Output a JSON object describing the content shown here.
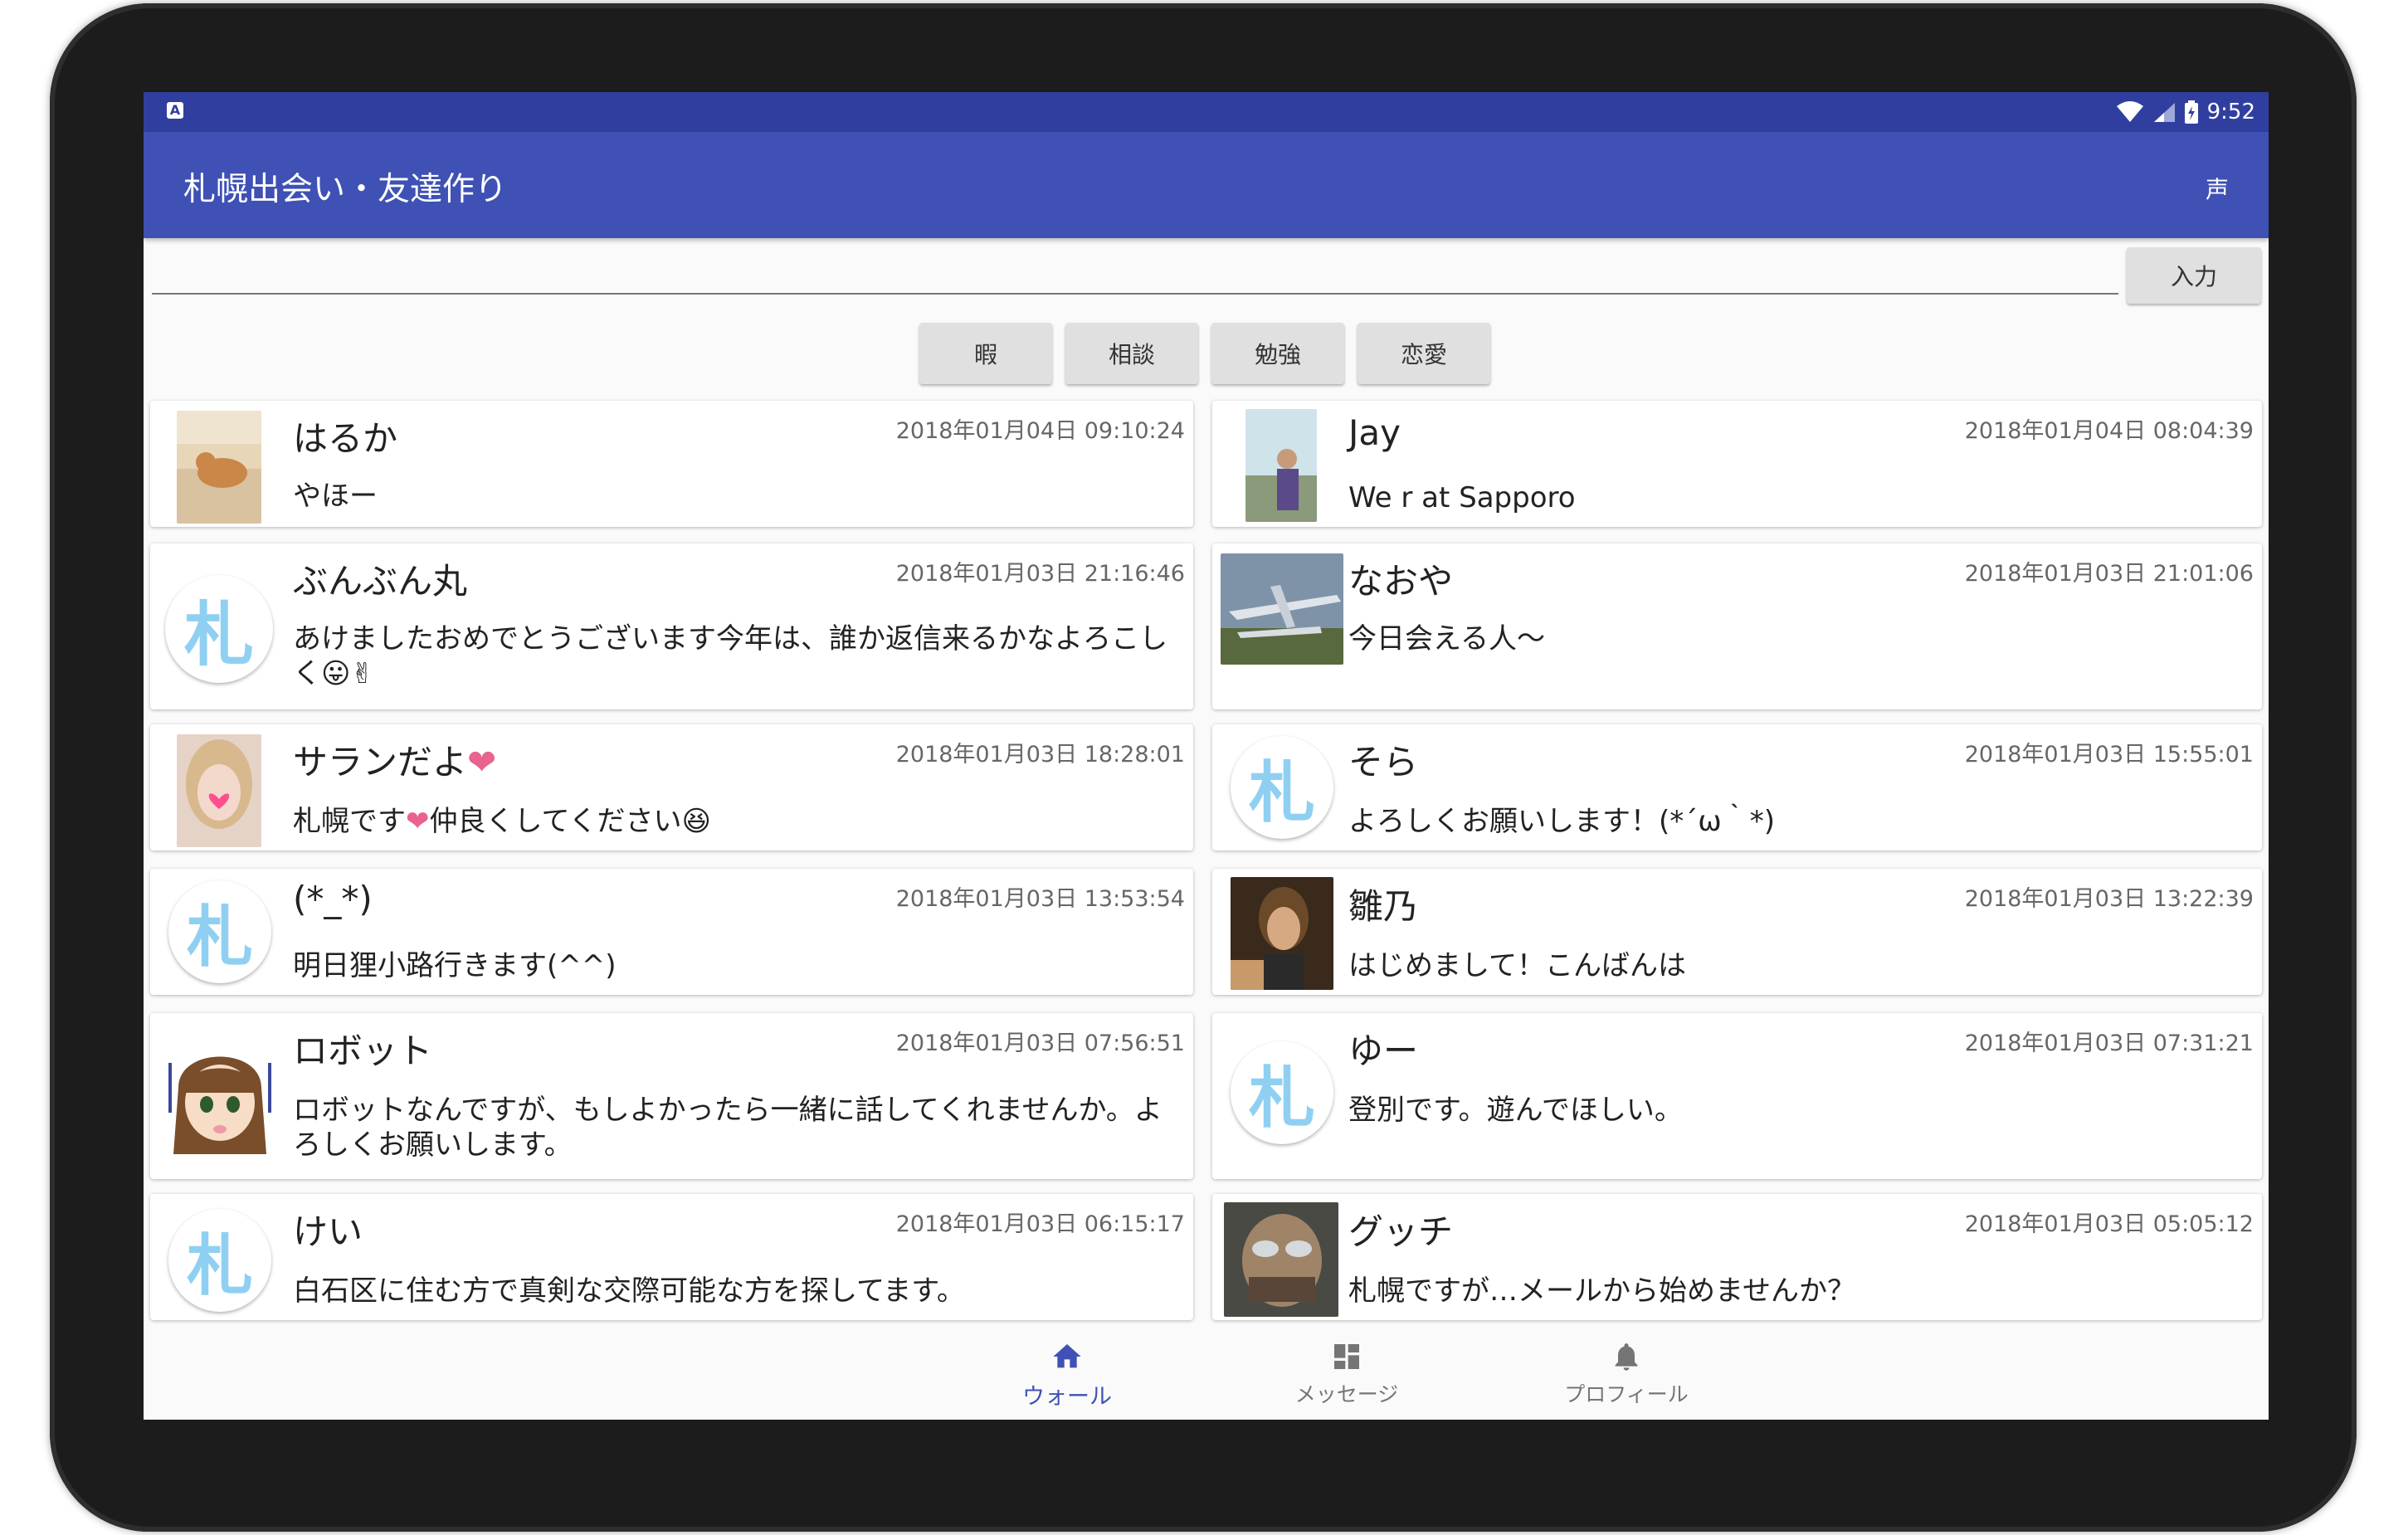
{
  "status_bar": {
    "notification_icon": "A",
    "time": "9:52",
    "icons": [
      "wifi-icon",
      "signal-icon",
      "battery-icon"
    ]
  },
  "app_bar": {
    "title": "札幌出会い・友達作り",
    "voice_label": "声"
  },
  "input": {
    "value": "",
    "placeholder": "",
    "submit_label": "入力"
  },
  "categories": [
    "暇",
    "相談",
    "勉強",
    "恋愛"
  ],
  "default_avatar_char": "札",
  "posts": [
    {
      "name": "はるか",
      "time": "2018年01月04日 09:10:24",
      "message": "やほー"
    },
    {
      "name": "Jay",
      "time": "2018年01月04日 08:04:39",
      "message": "We r at Sapporo"
    },
    {
      "name": "ぶんぶん丸",
      "time": "2018年01月03日 21:16:46",
      "message": "あけましたおめでとうございます今年は、誰か返信来るかなよろこしく😛✌"
    },
    {
      "name": "なおや",
      "time": "2018年01月03日 21:01:06",
      "message": "今日会える人〜"
    },
    {
      "name": "サランだよ",
      "name_suffix": "❤",
      "time": "2018年01月03日 18:28:01",
      "message": "札幌です",
      "message_mid": "❤",
      "message_end": "仲良くしてください😆"
    },
    {
      "name": "そら",
      "time": "2018年01月03日 15:55:01",
      "message": "よろしくお願いします！(*´ω｀*)"
    },
    {
      "name": "(*_*)",
      "time": "2018年01月03日 13:53:54",
      "message": "明日狸小路行きます(^^)"
    },
    {
      "name": "雛乃",
      "time": "2018年01月03日 13:22:39",
      "message": "はじめまして！こんばんは"
    },
    {
      "name": "ロボット",
      "time": "2018年01月03日 07:56:51",
      "message": "ロボットなんですが、もしよかったら一緒に話してくれませんか。よろしくお願いします。"
    },
    {
      "name": "ゆー",
      "time": "2018年01月03日 07:31:21",
      "message": "登別です。遊んでほしい。"
    },
    {
      "name": "けい",
      "time": "2018年01月03日 06:15:17",
      "message": "白石区に住む方で真剣な交際可能な方を探してます。"
    },
    {
      "name": "グッチ",
      "time": "2018年01月03日 05:05:12",
      "message": "札幌ですが…メールから始めませんか？"
    }
  ],
  "bottom_nav": [
    {
      "label": "ウォール",
      "icon": "home-icon",
      "active": true
    },
    {
      "label": "メッセージ",
      "icon": "dashboard-icon",
      "active": false
    },
    {
      "label": "プロフィール",
      "icon": "bell-icon",
      "active": false
    }
  ],
  "colors": {
    "primary": "#3f51b5",
    "primary_dark": "#303f9f",
    "avatar_char": "#8fd0f2"
  }
}
